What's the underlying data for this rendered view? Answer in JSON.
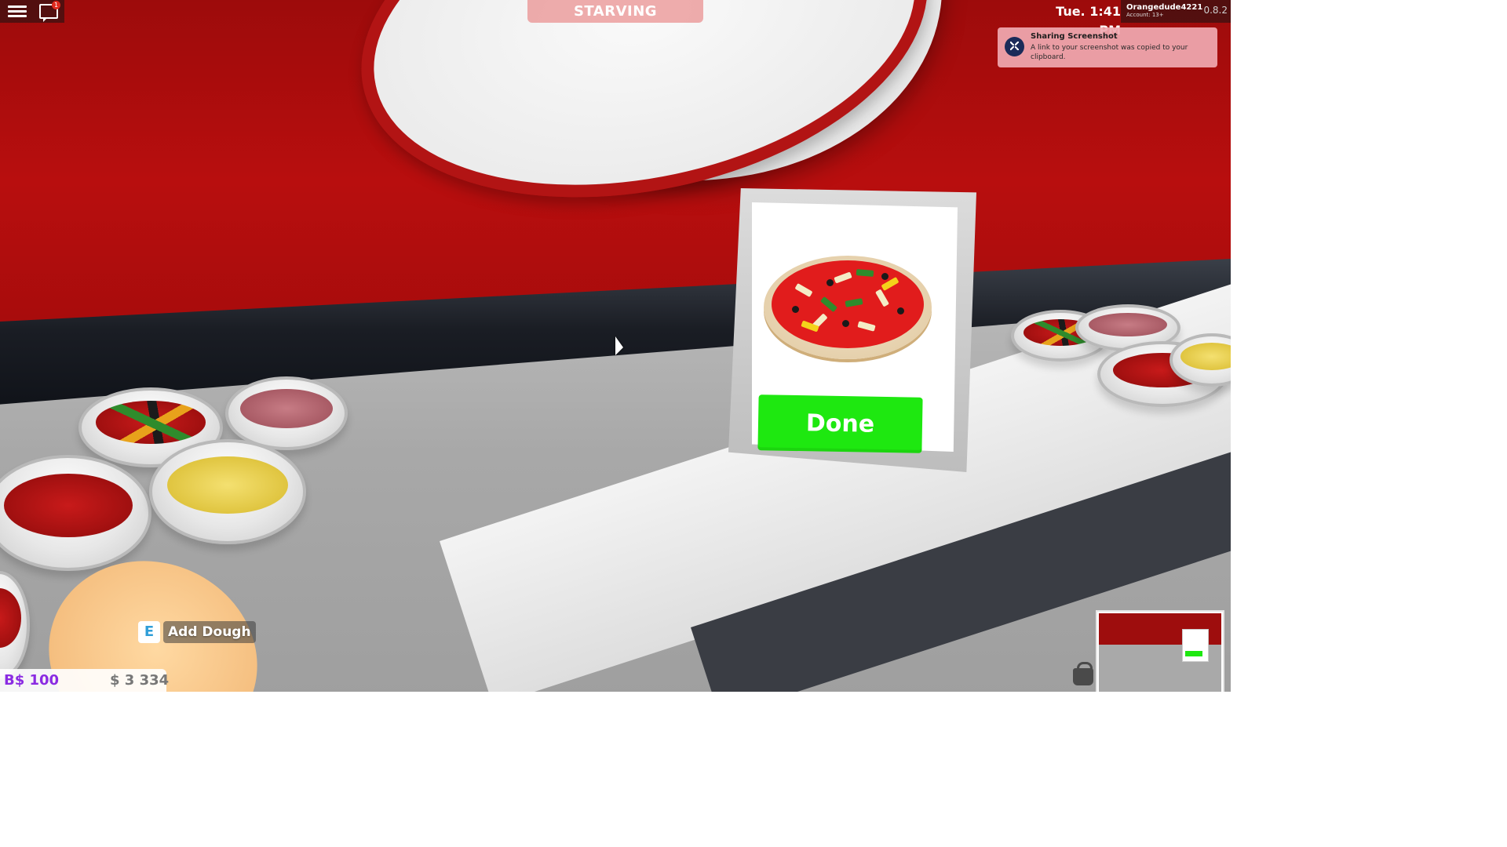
{
  "hud": {
    "hunger_status": "STARVING",
    "clock": "Tue. 1:41 PM",
    "account_name": "Orangedude4221",
    "account_age": "Account: 13+",
    "version": "0.8.2",
    "chat_badge": "1"
  },
  "notification": {
    "title": "Sharing Screenshot",
    "body": "A link to your screenshot was copied to your clipboard."
  },
  "interaction": {
    "key": "E",
    "label": "Add Dough"
  },
  "order_card": {
    "button_label": "Done"
  },
  "currency": {
    "bux": "B$ 100",
    "cash": "$ 3 334"
  },
  "colors": {
    "done_button": "#1ee810",
    "wall_red": "#b80e0e",
    "bux_purple": "#8a2be2"
  },
  "icons": {
    "menu": "hamburger-menu-icon",
    "chat": "chat-icon",
    "notification": "dropbox-icon",
    "shop": "shopping-basket-icon"
  }
}
